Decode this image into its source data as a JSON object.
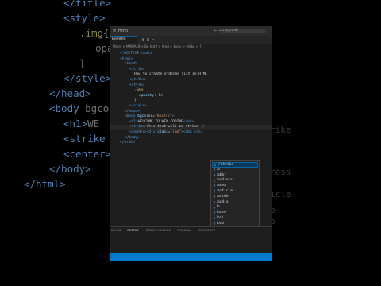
{
  "background_code": {
    "lines": [
      {
        "parts": [
          {
            "c": "a",
            "t": "</title>"
          }
        ]
      },
      {
        "parts": [
          {
            "c": "a",
            "t": "<style>"
          }
        ]
      },
      {
        "parts": [
          {
            "c": "y",
            "t": ".img{"
          }
        ]
      },
      {
        "parts": [
          {
            "c": "w",
            "t": "opaci"
          }
        ]
      },
      {
        "parts": [
          {
            "c": "w",
            "t": "}"
          }
        ]
      },
      {
        "parts": [
          {
            "c": "a",
            "t": "</style>"
          }
        ]
      },
      {
        "parts": [
          {
            "c": "a",
            "t": "</head>"
          }
        ]
      },
      {
        "parts": [
          {
            "c": "a",
            "t": "<body "
          },
          {
            "c": "w",
            "t": "bgcolo"
          }
        ]
      },
      {
        "parts": [
          {
            "c": "a",
            "t": "<h1>"
          },
          {
            "c": "w",
            "t": "WE"
          }
        ]
      },
      {
        "parts": [
          {
            "c": "a",
            "t": "<strike"
          }
        ]
      },
      {
        "parts": [
          {
            "c": "a",
            "t": "<center>"
          },
          {
            "c": "w",
            "t": "<i"
          }
        ]
      },
      {
        "parts": [
          {
            "c": "a",
            "t": "</body>"
          }
        ]
      },
      {
        "parts": [
          {
            "c": "a",
            "t": "</html>"
          }
        ]
      }
    ],
    "right_ghost": [
      "rike",
      "ress",
      "icle",
      "e",
      "o"
    ]
  },
  "window": {
    "title": "Html",
    "search_placeholder": "a_code",
    "tab_label": "Be.html",
    "breadcrumb": "Users > MAMAL9 > Be.html > html > body > strike > ?"
  },
  "editor_lines": [
    {
      "indent": 0,
      "tokens": [
        {
          "c": "t",
          "t": "<!DOCTYPE html>"
        }
      ]
    },
    {
      "indent": 0,
      "tokens": [
        {
          "c": "t",
          "t": "<html>"
        }
      ]
    },
    {
      "indent": 1,
      "tokens": [
        {
          "c": "t",
          "t": "<head>"
        }
      ]
    },
    {
      "indent": 2,
      "tokens": [
        {
          "c": "t",
          "t": "<title>"
        }
      ]
    },
    {
      "indent": 3,
      "tokens": [
        {
          "c": "x",
          "t": "How to create ordered list in HTML"
        }
      ]
    },
    {
      "indent": 2,
      "tokens": [
        {
          "c": "t",
          "t": "</title>"
        }
      ]
    },
    {
      "indent": 2,
      "tokens": [
        {
          "c": "t",
          "t": "<style>"
        }
      ]
    },
    {
      "indent": 3,
      "tokens": [
        {
          "c": "sel",
          "t": ".img{"
        }
      ]
    },
    {
      "indent": 4,
      "tokens": [
        {
          "c": "pr",
          "t": "opacity: "
        },
        {
          "c": "v",
          "t": "1s"
        },
        {
          "c": "x",
          "t": ";"
        }
      ]
    },
    {
      "indent": 3,
      "tokens": [
        {
          "c": "x",
          "t": "}"
        }
      ]
    },
    {
      "indent": 2,
      "tokens": [
        {
          "c": "t",
          "t": "</style>"
        }
      ]
    },
    {
      "indent": 1,
      "tokens": [
        {
          "c": "t",
          "t": "</head>"
        }
      ]
    },
    {
      "indent": 1,
      "tokens": [
        {
          "c": "t",
          "t": "<body "
        },
        {
          "c": "at",
          "t": "bgcolor"
        },
        {
          "c": "x",
          "t": "="
        },
        {
          "c": "s",
          "t": "\"#A2A47\""
        },
        {
          "c": "t",
          "t": ">"
        }
      ]
    },
    {
      "indent": 2,
      "tokens": [
        {
          "c": "t",
          "t": "<h1>"
        },
        {
          "c": "x",
          "t": "WELCOME TO WEB CODING"
        },
        {
          "c": "t",
          "t": "</h1>"
        }
      ]
    },
    {
      "indent": 2,
      "tokens": [
        {
          "c": "t",
          "t": "<strike>"
        },
        {
          "c": "x",
          "t": "this text will be strike "
        },
        {
          "c": "t",
          "t": "</"
        }
      ]
    },
    {
      "indent": 2,
      "tokens": [
        {
          "c": "t",
          "t": "<center>"
        },
        {
          "c": "t",
          "t": "<div "
        },
        {
          "c": "at",
          "t": "class"
        },
        {
          "c": "x",
          "t": "="
        },
        {
          "c": "s",
          "t": "\"img\""
        },
        {
          "c": "t",
          "t": "><img src="
        }
      ]
    },
    {
      "indent": 1,
      "tokens": [
        {
          "c": "t",
          "t": "</body>"
        }
      ]
    },
    {
      "indent": 0,
      "tokens": [
        {
          "c": "t",
          "t": "</html>"
        }
      ]
    }
  ],
  "suggestions": [
    "/strike",
    "a",
    "abbr",
    "address",
    "area",
    "article",
    "aside",
    "audio",
    "b",
    "base",
    "bdi",
    "bdo"
  ],
  "selected_suggestion_index": 0,
  "panel_tabs": [
    "BLEMS",
    "OUTPUT",
    "DEBUG CONSOLE",
    "TERMINAL",
    "COMMENTS"
  ],
  "active_panel_tab_index": 1,
  "status_bar_color": "#007acc"
}
